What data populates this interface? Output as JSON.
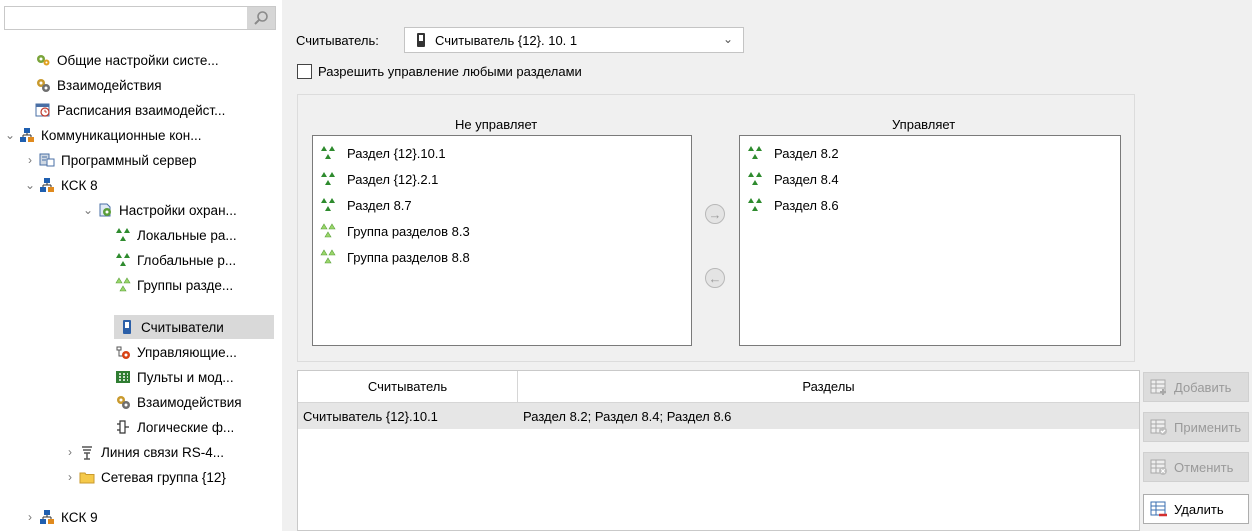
{
  "tree": {
    "search_placeholder": "",
    "items": [
      {
        "label": "Общие настройки систе...",
        "icon": "gears-icon"
      },
      {
        "label": "Взаимодействия",
        "icon": "interaction-gears-icon"
      },
      {
        "label": "Расписания взаимодейст...",
        "icon": "schedule-icon"
      },
      {
        "label": "Коммуникационные кон...",
        "icon": "network-devices-icon"
      },
      {
        "label": "Программный сервер",
        "icon": "server-icon"
      },
      {
        "label": "КСК 8",
        "icon": "network-devices-icon"
      },
      {
        "label": "Настройки охран...",
        "icon": "security-settings-icon"
      },
      {
        "label": "Локальные ра...",
        "icon": "partition-icon"
      },
      {
        "label": "Глобальные р...",
        "icon": "partition-icon"
      },
      {
        "label": "Группы разде...",
        "icon": "partition-group-icon"
      },
      {
        "label": "Считыватели",
        "icon": "reader-icon"
      },
      {
        "label": "Управляющие...",
        "icon": "control-icon"
      },
      {
        "label": "Пульты и мод...",
        "icon": "panel-icon"
      },
      {
        "label": "Взаимодействия",
        "icon": "interaction-gears-icon"
      },
      {
        "label": "Логические ф...",
        "icon": "logic-icon"
      },
      {
        "label": "Линия связи RS-4...",
        "icon": "rs485-line-icon"
      },
      {
        "label": "Сетевая группа {12}",
        "icon": "folder-icon"
      },
      {
        "label": "КСК 9",
        "icon": "network-devices-icon"
      }
    ]
  },
  "reader": {
    "label": "Считыватель:",
    "selected": "Считыватель {12}. 10. 1"
  },
  "allow_all": {
    "label": "Разрешить управление любыми разделами",
    "checked": false
  },
  "not_managed": {
    "header": "Не управляет",
    "items": [
      {
        "label": "Раздел {12}.10.1",
        "icon": "partition-icon"
      },
      {
        "label": "Раздел {12}.2.1",
        "icon": "partition-icon"
      },
      {
        "label": "Раздел 8.7",
        "icon": "partition-icon"
      },
      {
        "label": "Группа разделов 8.3",
        "icon": "partition-group-icon"
      },
      {
        "label": "Группа разделов 8.8",
        "icon": "partition-group-icon"
      }
    ]
  },
  "managed": {
    "header": "Управляет",
    "items": [
      {
        "label": "Раздел 8.2",
        "icon": "partition-icon"
      },
      {
        "label": "Раздел 8.4",
        "icon": "partition-icon"
      },
      {
        "label": "Раздел 8.6",
        "icon": "partition-icon"
      }
    ]
  },
  "table": {
    "columns": [
      "Считыватель",
      "Разделы"
    ],
    "rows": [
      [
        "Считыватель {12}.10.1",
        "Раздел 8.2; Раздел 8.4; Раздел 8.6"
      ]
    ]
  },
  "buttons": {
    "add": "Добавить",
    "apply": "Применить",
    "cancel": "Отменить",
    "delete": "Удалить"
  }
}
